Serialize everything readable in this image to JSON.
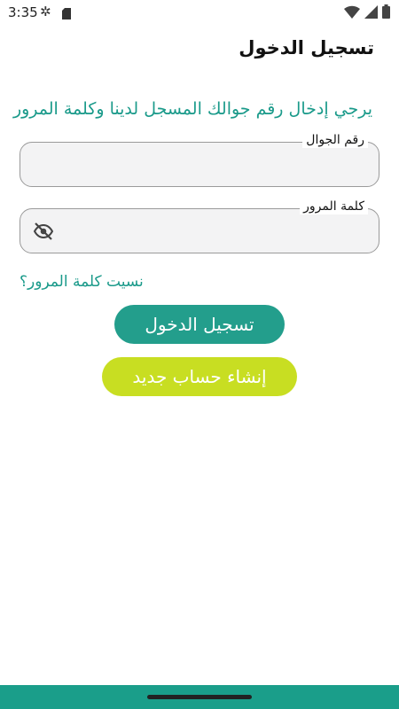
{
  "status_bar": {
    "time": "3:35",
    "icons": [
      "gear-icon",
      "sd-card-icon",
      "wifi-icon",
      "signal-icon",
      "battery-icon"
    ]
  },
  "header": {
    "title": "تسجيل الدخول"
  },
  "instruction": "يرجي إدخال رقم جوالك المسجل لدينا وكلمة المرور",
  "form": {
    "phone": {
      "label": "رقم الجوال",
      "value": ""
    },
    "password": {
      "label": "كلمة المرور",
      "value": ""
    }
  },
  "forgot_password": "نسيت كلمة المرور؟",
  "buttons": {
    "login": "تسجيل الدخول",
    "register": "إنشاء حساب جديد"
  },
  "colors": {
    "accent": "#239e8c",
    "secondary": "#c8de22",
    "link": "#1a9a8a"
  }
}
